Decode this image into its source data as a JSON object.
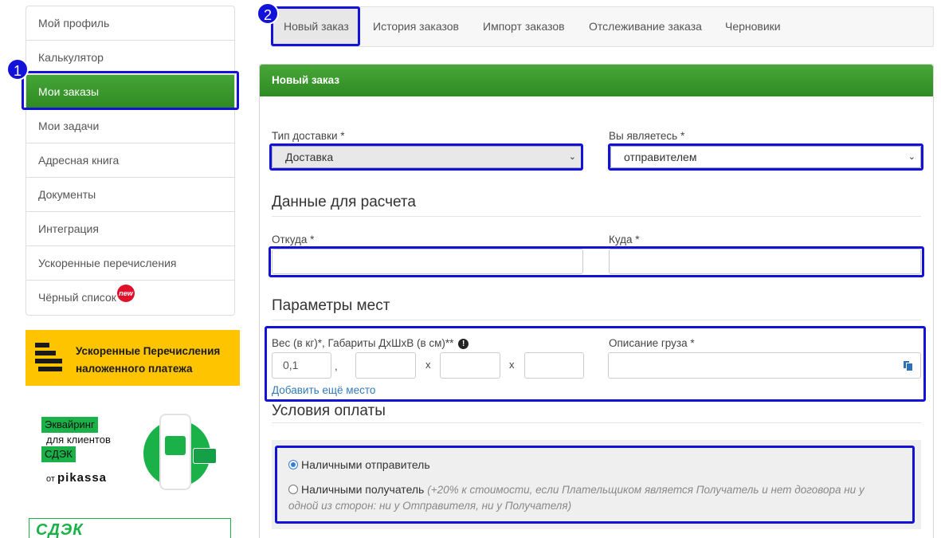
{
  "sidebar": {
    "items": [
      {
        "label": "Мой профиль"
      },
      {
        "label": "Калькулятор"
      },
      {
        "label": "Мои заказы"
      },
      {
        "label": "Мои задачи"
      },
      {
        "label": "Адресная книга"
      },
      {
        "label": "Документы"
      },
      {
        "label": "Интеграция"
      },
      {
        "label": "Ускоренные перечисления"
      },
      {
        "label": "Чёрный список"
      }
    ],
    "new_badge": "new"
  },
  "markers": {
    "m1": "1",
    "m2": "2"
  },
  "banners": {
    "accelerated_line1": "Ускоренные Перечисления",
    "accelerated_line2": "наложенного платежа",
    "acquiring_tag": "Эквайринг",
    "acquiring_line2": "для клиентов",
    "acquiring_tag2": "СДЭК",
    "pikassa_from": "от",
    "pikassa_brand": "pikassa",
    "cdek_logo": "СДЭК"
  },
  "tabs": [
    {
      "label": "Новый заказ"
    },
    {
      "label": "История заказов"
    },
    {
      "label": "Импорт заказов"
    },
    {
      "label": "Отслеживание заказа"
    },
    {
      "label": "Черновики"
    }
  ],
  "panel": {
    "title": "Новый заказ",
    "delivery_type_label": "Тип доставки *",
    "delivery_type_value": "Доставка",
    "you_are_label": "Вы являетесь *",
    "you_are_value": "отправителем",
    "calc_section": "Данные для расчета",
    "from_label": "Откуда *",
    "to_label": "Куда *",
    "places_section": "Параметры мест",
    "weight_label": "Вес (в кг)*, Габариты ДхШхВ (в см)**",
    "weight_value": "0,1",
    "comma": ",",
    "x1": "x",
    "x2": "x",
    "cargo_label": "Описание груза *",
    "add_place_link": "Добавить ещё место",
    "payment_section": "Условия оплаты",
    "pay_sender": "Наличными отправитель",
    "pay_receiver": "Наличными получатель",
    "pay_receiver_note_line1": "(+20% к стоимости, если Плательщиком является Получатель и нет договора ни у",
    "pay_receiver_note_line2": "одной из сторон: ни у Отправителя, ни у Получателя)"
  },
  "colors": {
    "accent": "#2e8b23",
    "annotation": "#1212d8",
    "link": "#337ab7"
  }
}
